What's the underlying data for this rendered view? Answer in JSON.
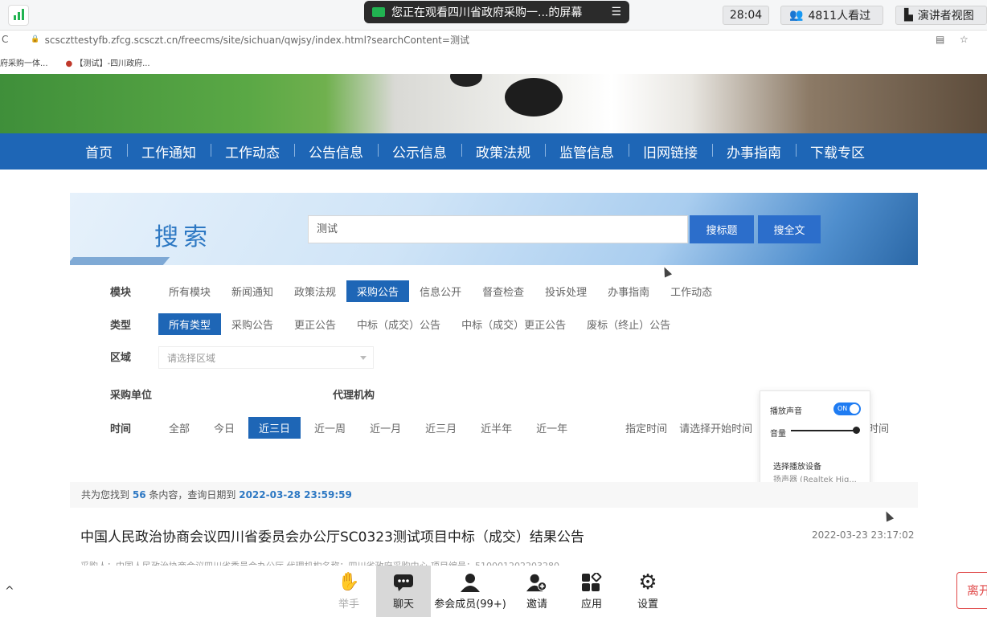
{
  "meeting": {
    "sharing_banner": "您正在观看四川省政府采购一...的屏幕",
    "timer": "28:04",
    "viewers": "4811人看过",
    "view_mode": "演讲者视图"
  },
  "browser": {
    "url": "scsczttestyfb.zfcg.scsczt.cn/freecms/site/sichuan/qwjsy/index.html?searchContent=测试",
    "bookmarks": [
      "府采购一体...",
      "【测试】-四川政府..."
    ]
  },
  "nav": {
    "items": [
      "首页",
      "工作通知",
      "工作动态",
      "公告信息",
      "公示信息",
      "政策法规",
      "监管信息",
      "旧网链接",
      "办事指南",
      "下载专区"
    ]
  },
  "search": {
    "title": "搜索",
    "query": "测试",
    "btn_title": "搜标题",
    "btn_full": "搜全文"
  },
  "filters": {
    "module_label": "模块",
    "modules": [
      "所有模块",
      "新闻通知",
      "政策法规",
      "采购公告",
      "信息公开",
      "督查检查",
      "投诉处理",
      "办事指南",
      "工作动态"
    ],
    "type_label": "类型",
    "types": [
      "所有类型",
      "采购公告",
      "更正公告",
      "中标（成交）公告",
      "中标（成交）更正公告",
      "废标（终止）公告"
    ],
    "region_label": "区域",
    "region_placeholder": "请选择区域",
    "purchaser_label": "采购单位",
    "agency_label": "代理机构",
    "time_label": "时间",
    "times": [
      "全部",
      "今日",
      "近三日",
      "近一周",
      "近一月",
      "近三月",
      "近半年",
      "近一年"
    ],
    "custom_time": "指定时间",
    "start_time": "请选择开始时间",
    "end_time": "时间"
  },
  "results": {
    "prefix": "共为您找到",
    "count": "56",
    "suffix": "条内容，查询日期到",
    "date": "2022-03-28 23:59:59",
    "first_title": "中国人民政治协商会议四川省委员会办公厅SC0323测试项目中标（成交）结果公告",
    "first_date": "2022-03-23 23:17:02",
    "first_sub": "采购人：中国人民政治协商会议四川省委员会办公厅    代理机构名称：四川省政府采购中心    项目编号：510001202203280"
  },
  "audio": {
    "play_sound": "播放声音",
    "toggle": "ON",
    "volume": "音量",
    "volume_level": 1.0,
    "device_label": "选择播放设备",
    "device_value": "扬声器 (Realtek Hig..."
  },
  "toolbar": {
    "raise_hand": "举手",
    "chat": "聊天",
    "members": "参会成员(99+)",
    "invite": "邀请",
    "apps": "应用",
    "settings": "设置",
    "leave": "离开"
  }
}
